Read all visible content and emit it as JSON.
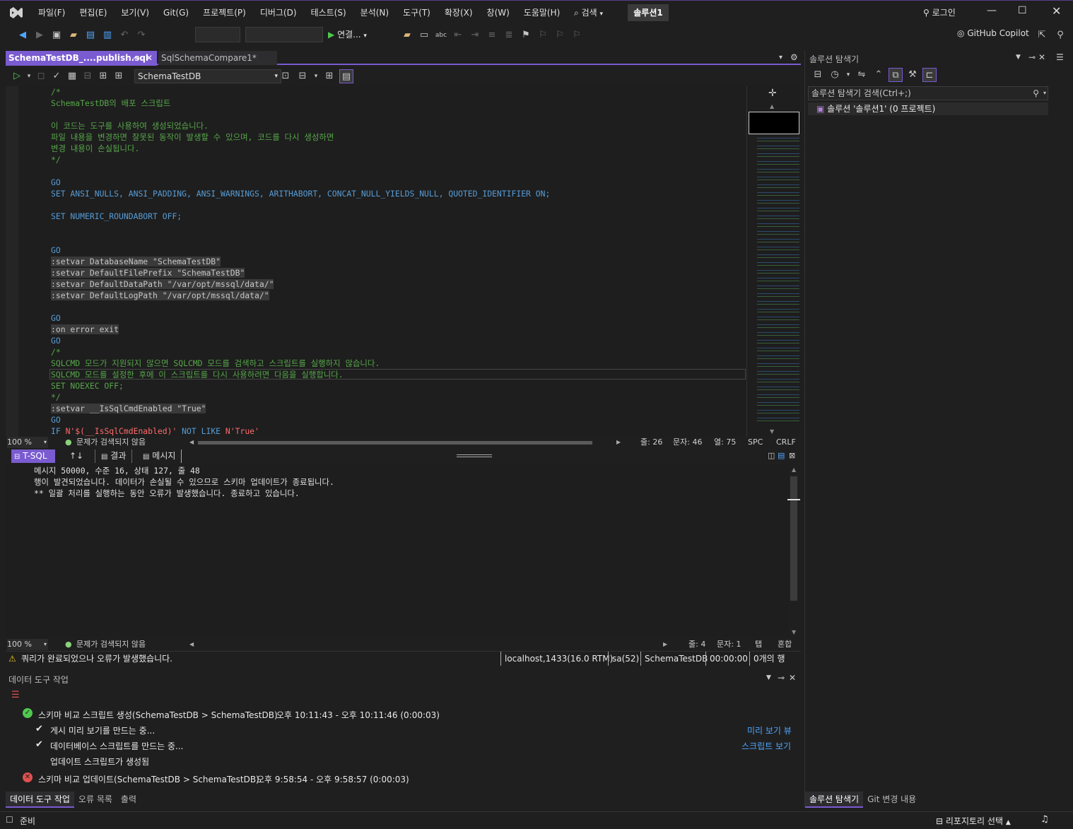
{
  "window": {
    "menu": [
      "파일(F)",
      "편집(E)",
      "보기(V)",
      "Git(G)",
      "프로젝트(P)",
      "디버그(D)",
      "테스트(S)",
      "분석(N)",
      "도구(T)",
      "확장(X)",
      "창(W)",
      "도움말(H)"
    ],
    "search_label": "검색",
    "solution_badge": "솔루션1",
    "login_label": "로그인",
    "copilot_label": "GitHub Copilot"
  },
  "toolbar": {
    "connect_label": "연결..."
  },
  "tabs": {
    "active": "SchemaTestDB_....publish.sql",
    "inactive": "SqlSchemaCompare1*"
  },
  "editor_toolbar": {
    "database": "SchemaTestDB"
  },
  "code_lines": [
    {
      "cls": "cm",
      "text": "/*"
    },
    {
      "cls": "cm",
      "text": "SchemaTestDB의 배포 스크립트"
    },
    {
      "cls": "cm",
      "text": ""
    },
    {
      "cls": "cm",
      "text": "이 코드는 도구를 사용하여 생성되었습니다."
    },
    {
      "cls": "cm",
      "text": "파일 내용을 변경하면 잘못된 동작이 발생할 수 있으며, 코드를 다시 생성하면"
    },
    {
      "cls": "cm",
      "text": "변경 내용이 손실됩니다."
    },
    {
      "cls": "cm",
      "text": "*/"
    },
    {
      "cls": "",
      "text": ""
    },
    {
      "cls": "kw",
      "text": "GO"
    },
    {
      "cls": "kw",
      "text": "SET ANSI_NULLS, ANSI_PADDING, ANSI_WARNINGS, ARITHABORT, CONCAT_NULL_YIELDS_NULL, QUOTED_IDENTIFIER ON;"
    },
    {
      "cls": "",
      "text": ""
    },
    {
      "cls": "kw",
      "text": "SET NUMERIC_ROUNDABORT OFF;"
    },
    {
      "cls": "",
      "text": ""
    },
    {
      "cls": "",
      "text": ""
    },
    {
      "cls": "kw",
      "text": "GO"
    },
    {
      "cls": "sq",
      "text": ":setvar DatabaseName \"SchemaTestDB\""
    },
    {
      "cls": "sq",
      "text": ":setvar DefaultFilePrefix \"SchemaTestDB\""
    },
    {
      "cls": "sq",
      "text": ":setvar DefaultDataPath \"/var/opt/mssql/data/\""
    },
    {
      "cls": "sq",
      "text": ":setvar DefaultLogPath \"/var/opt/mssql/data/\""
    },
    {
      "cls": "",
      "text": ""
    },
    {
      "cls": "kw",
      "text": "GO"
    },
    {
      "cls": "sq",
      "text": ":on error exit"
    },
    {
      "cls": "kw",
      "text": "GO"
    },
    {
      "cls": "cm",
      "text": "/*"
    },
    {
      "cls": "cm",
      "text": "SQLCMD 모드가 지원되지 않으면 SQLCMD 모드를 검색하고 스크립트를 실행하지 않습니다."
    },
    {
      "cls": "cm",
      "text": "SQLCMD 모드를 설정한 후에 이 스크립트를 다시 사용하려면 다음을 실행합니다."
    },
    {
      "cls": "cm",
      "text": "SET NOEXEC OFF;"
    },
    {
      "cls": "cm",
      "text": "*/"
    },
    {
      "cls": "sq",
      "text": ":setvar __IsSqlCmdEnabled \"True\""
    },
    {
      "cls": "kw",
      "text": "GO"
    },
    {
      "cls": "mix",
      "text": "IF N'$(__IsSqlCmdEnabled)' NOT LIKE N'True'"
    }
  ],
  "editor_status": {
    "zoom": "100 %",
    "issues": "문제가 검색되지 않음",
    "line": "줄: 26",
    "char": "문자: 46",
    "col": "열: 75",
    "spc": "SPC",
    "crlf": "CRLF"
  },
  "results_tabs": {
    "tsql": "T-SQL",
    "results": "결과",
    "messages": "메시지"
  },
  "output_lines": [
    "메시지 50000, 수준 16, 상태 127, 줄 48",
    "행이 발견되었습니다. 데이터가 손실될 수 있으므로 스키마 업데이트가 종료됩니다.",
    "** 일괄 처리를 실행하는 동안 오류가 발생했습니다. 종료하고 있습니다."
  ],
  "output_status": {
    "zoom": "100 %",
    "issues": "문제가 검색되지 않음",
    "line": "줄: 4",
    "char": "문자: 1",
    "tab": "탭",
    "mixed": "혼합"
  },
  "query_status": {
    "message": "쿼리가 완료되었으나 오류가 발생했습니다.",
    "server": "localhost,1433(16.0 RTM)",
    "user": "sa(52)",
    "db": "SchemaTestDB",
    "time": "00:00:00",
    "rows": "0개의 행"
  },
  "data_tools": {
    "title": "데이터 도구 작업",
    "op1": "스키마 비교 스크립트 생성(SchemaTestDB > SchemaTestDB)",
    "op1_time": "오후 10:11:43 - 오후 10:11:46 (0:00:03)",
    "step1": "게시 미리 보기를 만드는 중...",
    "step1_link": "미리 보기 뷰",
    "step2": "데이터베이스 스크립트를 만드는 중...",
    "step2_link": "스크립트 보기",
    "step3": "업데이트 스크립트가 생성됨",
    "op2": "스키마 비교 업데이트(SchemaTestDB > SchemaTestDB)",
    "op2_time": "오후 9:58:54 - 오후 9:58:57 (0:00:03)",
    "tabs": [
      "데이터 도구 작업",
      "오류 목록",
      "출력"
    ]
  },
  "solution_explorer": {
    "title": "솔루션 탐색기",
    "search_placeholder": "솔루션 탐색기 검색(Ctrl+;)",
    "root": "솔루션 '솔루션1' (0 프로젝트)",
    "tabs": [
      "솔루션 탐색기",
      "Git 변경 내용"
    ]
  },
  "status_bar": {
    "ready": "준비",
    "repo": "리포지토리 선택"
  },
  "colors": {
    "accent": "#7a5bd0",
    "comment": "#57a64a",
    "keyword": "#569cd6",
    "error": "#e05050",
    "link": "#4da6ff"
  }
}
